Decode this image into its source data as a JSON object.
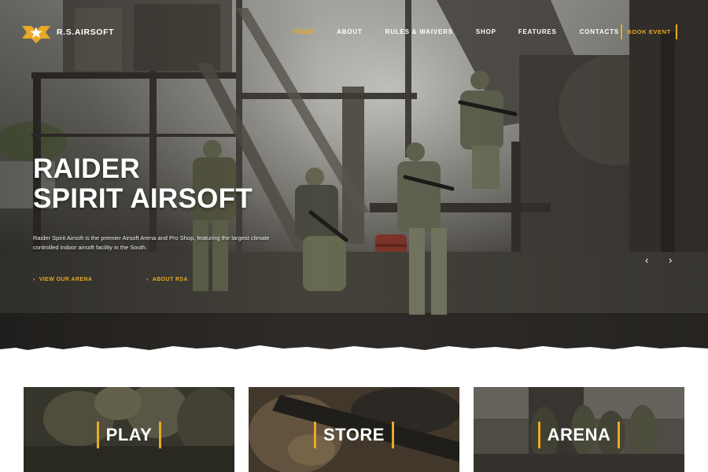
{
  "brand": {
    "name": "R.S.AIRSOFT",
    "accent_color": "#e8a828",
    "logo_icon": "star-chevron-badge"
  },
  "nav": {
    "items": [
      {
        "label": "HOME",
        "active": true
      },
      {
        "label": "ABOUT",
        "active": false
      },
      {
        "label": "RULES & WAIVERS",
        "active": false
      },
      {
        "label": "SHOP",
        "active": false
      },
      {
        "label": "FEATURES",
        "active": false
      },
      {
        "label": "CONTACTS",
        "active": false
      }
    ],
    "cta_label": "BOOK EVENT"
  },
  "hero": {
    "title_line1": "RAIDER",
    "title_line2": "SPIRIT AIRSOFT",
    "description": "Raider Spirit Airsoft is the premier Airsoft Arena and Pro Shop, featuring the largest climate controlled indoor airsoft facility in the South.",
    "links": [
      {
        "label": "VIEW OUR ARENA",
        "icon": "chevron-right-icon"
      },
      {
        "label": "ABOUT RSA",
        "icon": "chevron-right-icon"
      }
    ],
    "slider_prev_icon": "‹",
    "slider_next_icon": "›"
  },
  "cards": [
    {
      "label": "PLAY"
    },
    {
      "label": "STORE"
    },
    {
      "label": "ARENA"
    }
  ]
}
